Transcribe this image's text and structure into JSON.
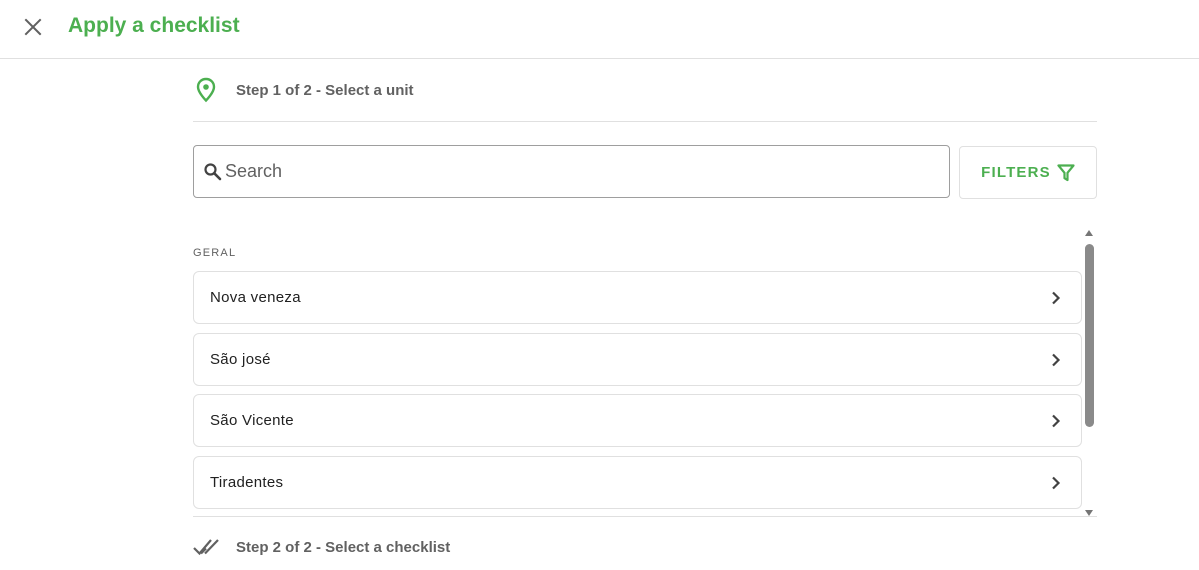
{
  "header": {
    "close_icon": "close-icon",
    "title": "Apply a checklist",
    "accent_color": "#4caf50"
  },
  "step1": {
    "icon": "location-pin-icon",
    "label": "Step 1 of 2 - Select a unit"
  },
  "search": {
    "icon": "search-icon",
    "placeholder": "Search",
    "value": ""
  },
  "filters": {
    "label": "FILTERS",
    "icon": "funnel-icon"
  },
  "units": {
    "group_label": "GERAL",
    "items": [
      {
        "label": "Nova veneza",
        "icon": "chevron-right-icon"
      },
      {
        "label": "São josé",
        "icon": "chevron-right-icon"
      },
      {
        "label": "São Vicente",
        "icon": "chevron-right-icon"
      },
      {
        "label": "Tiradentes",
        "icon": "chevron-right-icon"
      }
    ]
  },
  "step2": {
    "icon": "double-check-icon",
    "label": "Step 2 of 2 - Select a checklist"
  }
}
